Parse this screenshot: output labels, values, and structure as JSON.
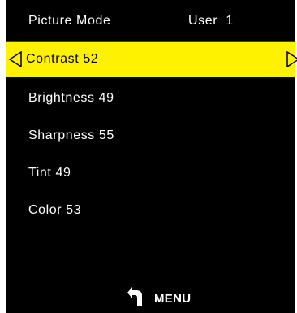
{
  "header": {
    "label": "Picture Mode",
    "value": "User  1"
  },
  "menu": {
    "items": [
      {
        "label": "Contrast 52",
        "selected": true
      },
      {
        "label": "Brightness 49",
        "selected": false
      },
      {
        "label": "Sharpness 55",
        "selected": false
      },
      {
        "label": "Tint 49",
        "selected": false
      },
      {
        "label": "Color 53",
        "selected": false
      }
    ]
  },
  "footer": {
    "label": "MENU",
    "icon": "return-arrow-icon"
  },
  "colors": {
    "background": "#000000",
    "highlight": "#fff200",
    "text": "#ffffff",
    "selected_text": "#000000"
  }
}
